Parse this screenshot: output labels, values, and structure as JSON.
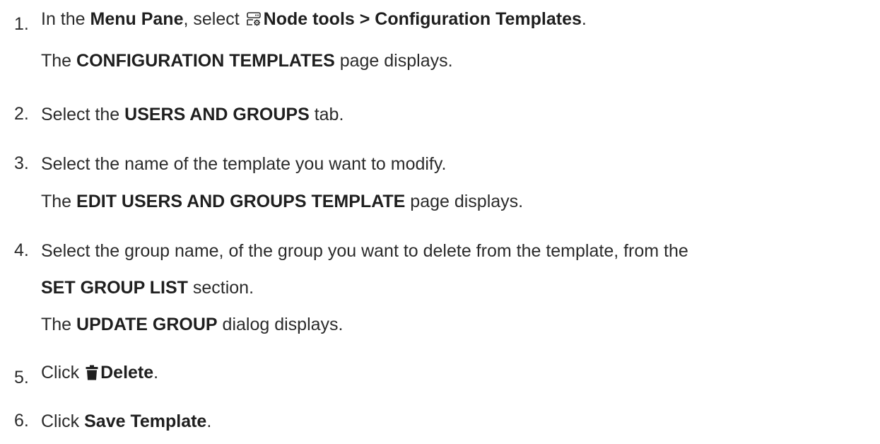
{
  "steps": [
    {
      "number": "1.",
      "text_before": "In the ",
      "bold1": "Menu Pane",
      "text_mid": ", select ",
      "icon": "node-tools-icon",
      "bold2": "Node tools > Configuration Templates",
      "text_after": ".",
      "result": {
        "before": "The ",
        "bold": "CONFIGURATION TEMPLATES",
        "after": " page displays."
      }
    },
    {
      "number": "2.",
      "text_before": "Select the ",
      "bold": "USERS AND GROUPS",
      "text_after": " tab."
    },
    {
      "number": "3.",
      "text": "Select the name of the template you want to modify.",
      "result": {
        "before": "The ",
        "bold": "EDIT USERS AND GROUPS TEMPLATE",
        "after": " page displays."
      }
    },
    {
      "number": "4.",
      "text": "Select the group name, of the group you want to delete from the template, from the",
      "line2_bold": "SET GROUP LIST",
      "line2_after": " section.",
      "result": {
        "before": "The ",
        "bold": "UPDATE GROUP",
        "after": " dialog displays."
      }
    },
    {
      "number": "5.",
      "text_before": "Click ",
      "icon": "trash-icon",
      "bold": "Delete",
      "text_after": "."
    },
    {
      "number": "6.",
      "text_before": "Click ",
      "bold": "Save Template",
      "text_after": "."
    }
  ]
}
